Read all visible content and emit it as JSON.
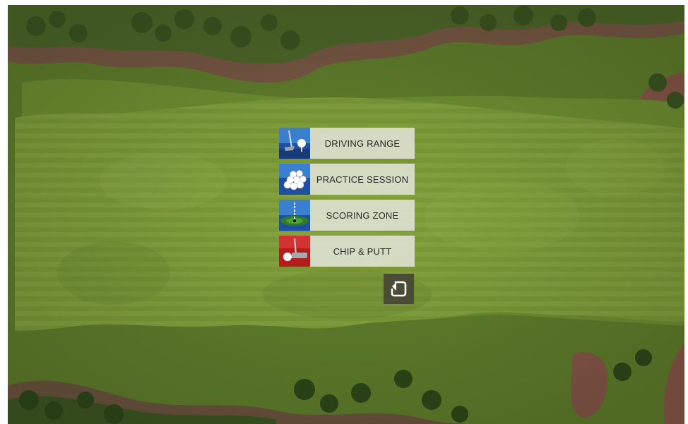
{
  "menu": {
    "items": [
      {
        "id": "driving-range",
        "label": "DRIVING RANGE",
        "icon": "tee-ball-icon",
        "icon_color": "#1f4fa3"
      },
      {
        "id": "practice-session",
        "label": "PRACTICE SESSION",
        "icon": "ball-bucket-icon",
        "icon_color": "#1f4fa3"
      },
      {
        "id": "scoring-zone",
        "label": "SCORING ZONE",
        "icon": "target-green-icon",
        "icon_color": "#1f4fa3"
      },
      {
        "id": "chip-putt",
        "label": "CHIP & PUTT",
        "icon": "putter-icon",
        "icon_color": "#b51c1c"
      }
    ]
  },
  "back_button": {
    "icon": "return-arrow-icon"
  },
  "colors": {
    "fairway": "#7f9e3a",
    "rough": "#5d7a2a",
    "bunker": "#8a5a4a",
    "menu_label_bg": "#e1e2d6",
    "back_button_bg": "#4a4c36"
  }
}
